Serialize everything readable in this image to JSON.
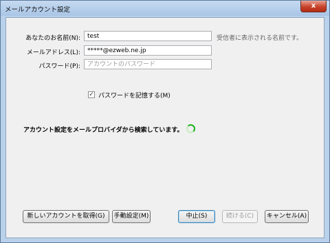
{
  "window": {
    "title": "メールアカウント設定",
    "close": "x"
  },
  "form": {
    "name_label": "あなたのお名前(N):",
    "name_value": "test",
    "name_hint": "受信者に表示される名前です。",
    "email_label": "メールアドレス(L):",
    "email_value": "*****@ezweb.ne.jp",
    "password_label": "パスワード(P):",
    "password_placeholder": "アカウントのパスワード",
    "remember_checked": true,
    "remember_label": "パスワードを記憶する(M)"
  },
  "status": {
    "text": "アカウント設定をメールプロバイダから検索しています。"
  },
  "buttons": {
    "get_new_account": "新しいアカウントを取得(G)",
    "manual_setup": "手動設定(M)",
    "stop": "中止(S)",
    "continue": "続ける(C)",
    "cancel": "キャンセル(A)"
  }
}
